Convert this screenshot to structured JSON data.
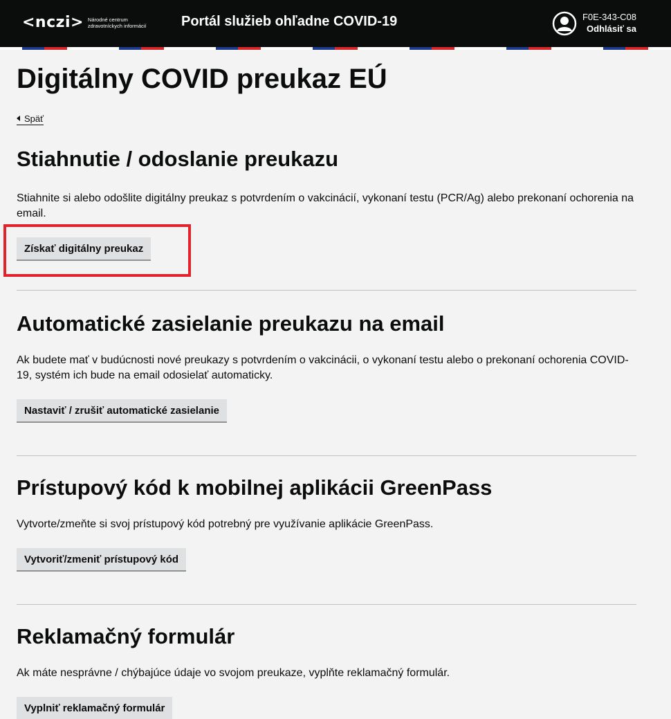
{
  "header": {
    "logo_mark": "<nczi>",
    "logo_sub": "Národné centrum zdravotníckych informácií",
    "title": "Portál služieb ohľadne COVID-19",
    "user_id": "F0E-343-C08",
    "logout_label": "Odhlásiť sa"
  },
  "page": {
    "title": "Digitálny COVID preukaz EÚ",
    "back_label": "Späť"
  },
  "sections": [
    {
      "heading": "Stiahnutie / odoslanie preukazu",
      "text": "Stiahnite si alebo odošlite digitálny preukaz s potvrdením o vakcinácií, vykonaní testu (PCR/Ag) alebo prekonaní ochorenia na email.",
      "button": "Získať digitálny preukaz"
    },
    {
      "heading": "Automatické zasielanie preukazu na email",
      "text": "Ak budete mať v budúcnosti nové preukazy s potvrdením o vakcinácii, o vykonaní testu alebo o prekonaní ochorenia COVID-19, systém ich bude na email odosielať automaticky.",
      "button": "Nastaviť / zrušiť automatické zasielanie"
    },
    {
      "heading": "Prístupový kód k mobilnej aplikácii GreenPass",
      "text": "Vytvorte/zmeňte si svoj prístupový kód potrebný pre využívanie aplikácie GreenPass.",
      "button": "Vytvoriť/zmeniť prístupový kód"
    },
    {
      "heading": "Reklamačný formulár",
      "text": "Ak máte nesprávne / chýbajúce údaje vo svojom preukaze, vyplňte reklamačný formulár.",
      "button": "Vyplniť reklamačný formulár"
    }
  ],
  "colors": {
    "header_bg": "#0b0c0c",
    "page_bg": "#f3f3f4",
    "button_bg": "#dee0e2",
    "highlight": "#e3232b"
  },
  "icons": {
    "avatar": "user-circle-icon",
    "back": "triangle-left-icon"
  }
}
